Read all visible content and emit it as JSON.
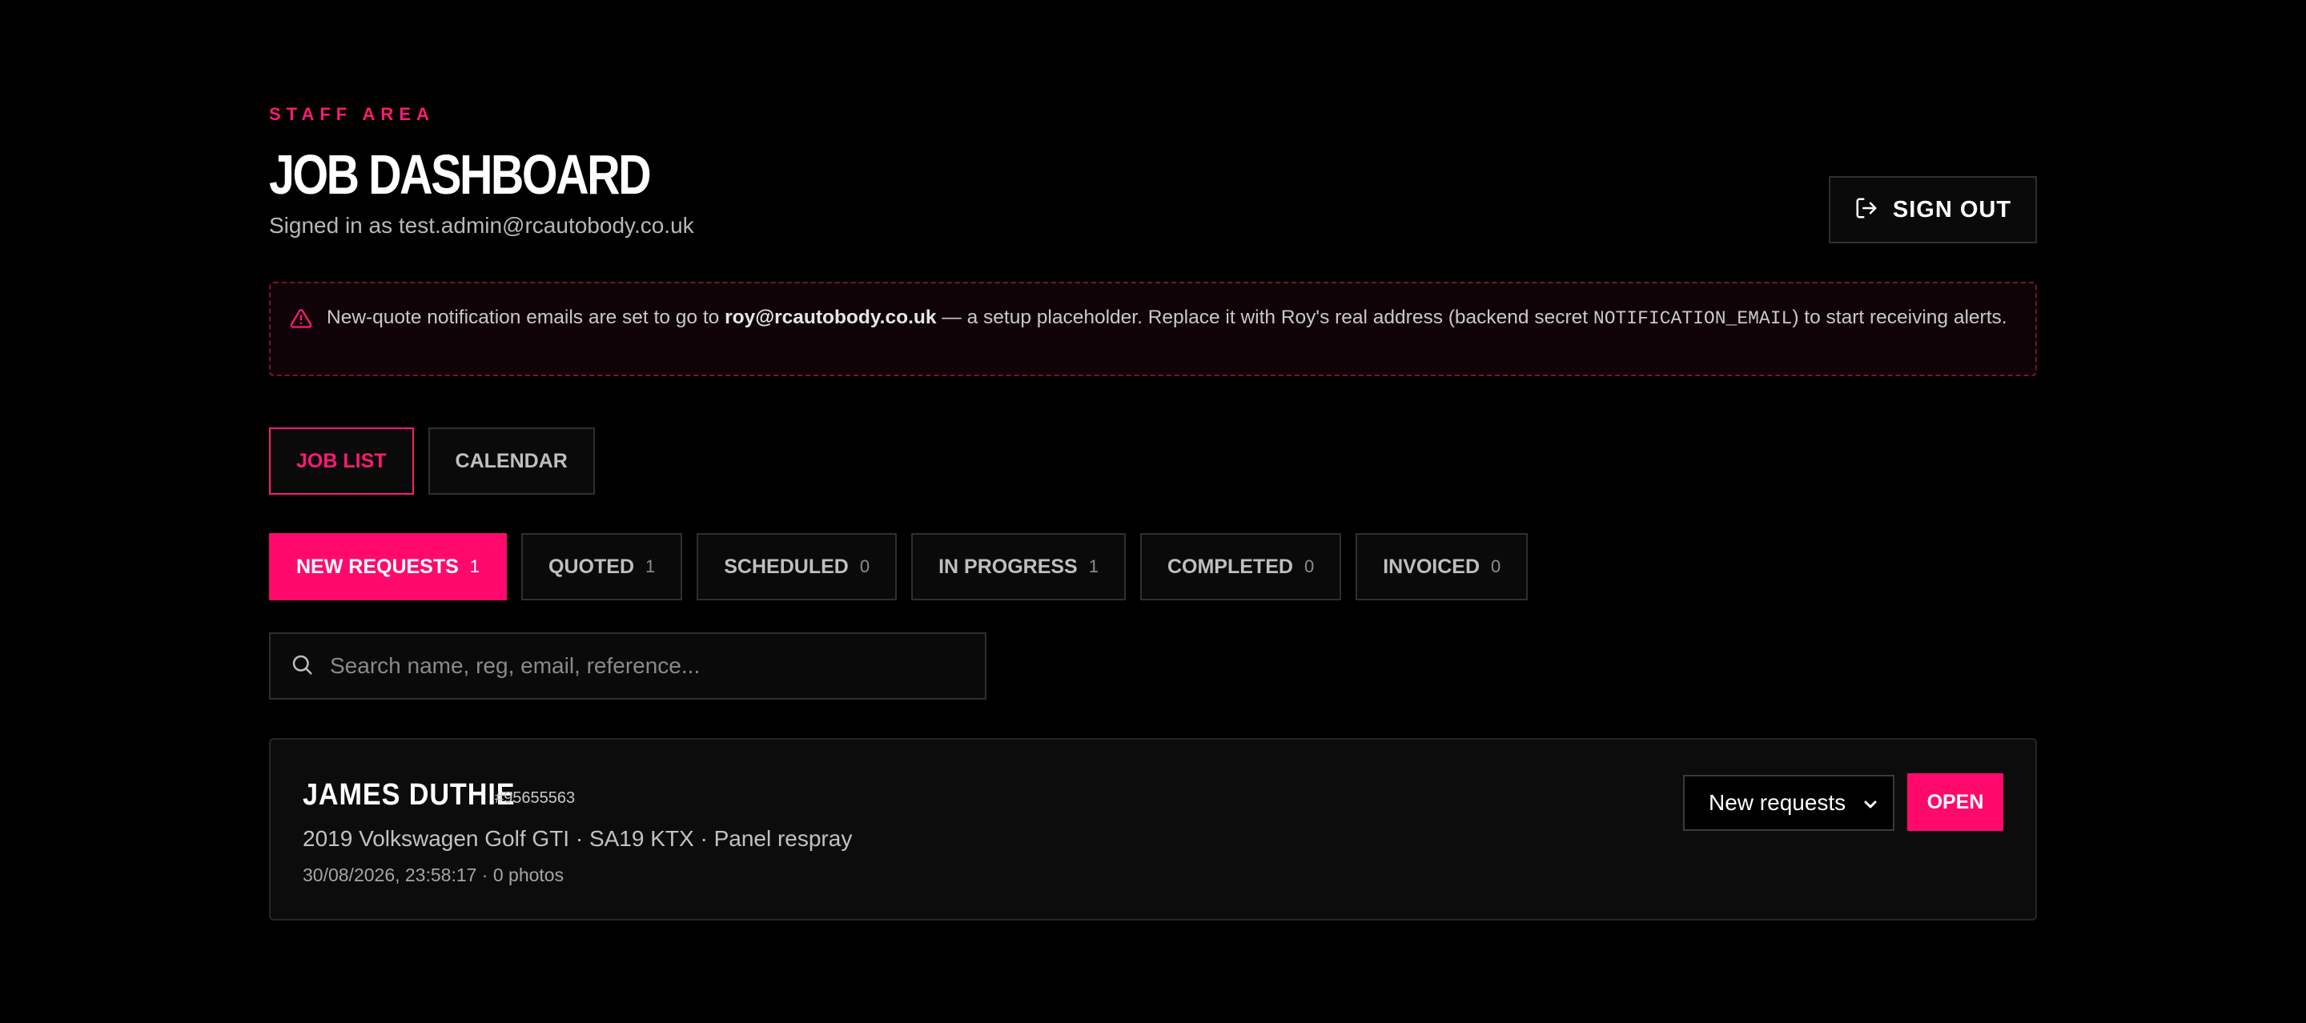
{
  "header": {
    "eyebrow": "STAFF AREA",
    "title": "JOB DASHBOARD",
    "signed_in": "Signed in as test.admin@rcautobody.co.uk",
    "sign_out_label": "SIGN OUT"
  },
  "alert": {
    "text_before": "New-quote notification emails are set to go to ",
    "email": "roy@rcautobody.co.uk",
    "text_middle": " — a setup placeholder. Replace it with Roy's real address (backend secret ",
    "secret": "NOTIFICATION_EMAIL",
    "text_after": ") to start receiving alerts."
  },
  "view_tabs": [
    {
      "label": "JOB LIST",
      "active": true
    },
    {
      "label": "CALENDAR",
      "active": false
    }
  ],
  "status_tabs": [
    {
      "label": "NEW REQUESTS",
      "count": "1",
      "active": true
    },
    {
      "label": "QUOTED",
      "count": "1",
      "active": false
    },
    {
      "label": "SCHEDULED",
      "count": "0",
      "active": false
    },
    {
      "label": "IN PROGRESS",
      "count": "1",
      "active": false
    },
    {
      "label": "COMPLETED",
      "count": "0",
      "active": false
    },
    {
      "label": "INVOICED",
      "count": "0",
      "active": false
    }
  ],
  "search": {
    "placeholder": "Search name, reg, email, reference..."
  },
  "jobs": [
    {
      "name": "JAMES DUTHIE",
      "reference": "#95655563",
      "description": "2019 Volkswagen Golf GTI · SA19 KTX · Panel respray",
      "meta": "30/08/2026, 23:58:17 · 0 photos",
      "status_value": "New requests",
      "open_label": "OPEN"
    }
  ],
  "colors": {
    "accent": "#ff0a6c",
    "background": "#000000",
    "border": "#2f2f2f"
  },
  "icons": {
    "sign_out": "sign-out-icon",
    "warning": "warning-triangle-icon",
    "search": "search-icon",
    "select": "chevron-down-icon"
  }
}
